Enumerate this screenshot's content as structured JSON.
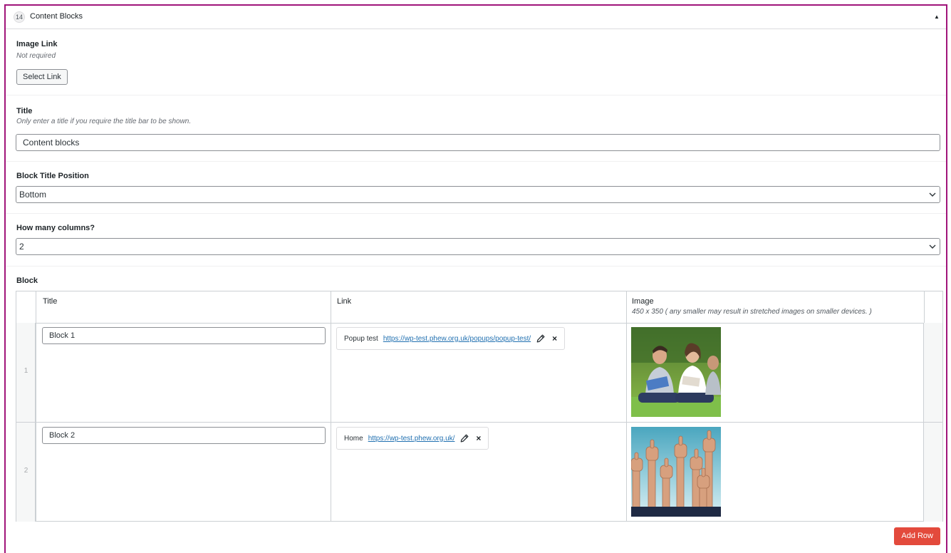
{
  "header": {
    "badge": "14",
    "title": "Content Blocks",
    "toggle": "▲"
  },
  "image_link": {
    "label": "Image Link",
    "hint": "Not required",
    "button_label": "Select Link"
  },
  "title_field": {
    "label": "Title",
    "hint": "Only enter a title if you require the title bar to be shown.",
    "value": "Content blocks"
  },
  "block_title_position": {
    "label": "Block Title Position",
    "selected": "Bottom"
  },
  "columns": {
    "label": "How many columns?",
    "selected": "2"
  },
  "block": {
    "label": "Block",
    "headers": {
      "title": "Title",
      "link": "Link",
      "image": "Image",
      "image_hint": "450 x 350 ( any smaller may result in stretched images on smaller devices. )"
    },
    "rows": [
      {
        "num": "1",
        "title": "Block 1",
        "link_title": "Popup test",
        "link_url": "https://wp-test.phew.org.uk/popups/popup-test/",
        "image_icon": "students-photo"
      },
      {
        "num": "2",
        "title": "Block 2",
        "link_title": "Home",
        "link_url": "https://wp-test.phew.org.uk/",
        "image_icon": "thumbs-up-photo"
      }
    ],
    "add_row_label": "Add Row"
  },
  "colors": {
    "frame": "#a0147a",
    "accent_link": "#2271b1",
    "add_row": "#e34a3c"
  }
}
